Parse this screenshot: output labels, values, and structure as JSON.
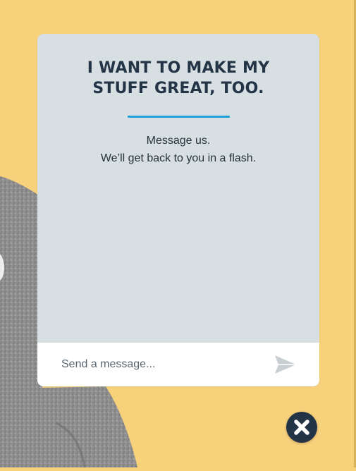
{
  "chat": {
    "title": "I WANT TO MAKE MY STUFF GREAT, TOO.",
    "subtitle_line1": "Message us.",
    "subtitle_line2": "We’ll get back to you in a flash.",
    "composer": {
      "placeholder": "Send a message...",
      "value": ""
    }
  },
  "icons": {
    "send": "paper-plane-send-icon",
    "close": "close-x-icon"
  },
  "colors": {
    "page_background": "#f8d17b",
    "panel_background": "#d8dfe2",
    "title_text": "#243447",
    "accent_underline": "#1d9fd8",
    "close_button": "#243447",
    "send_icon": "#c8cfd3"
  }
}
